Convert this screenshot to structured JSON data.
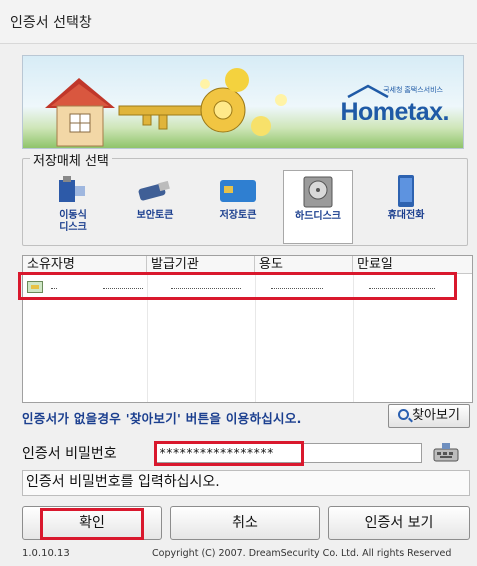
{
  "window": {
    "title": "인증서 선택창"
  },
  "banner": {
    "logo_text": "Hometax.",
    "logo_sub": "국세청 홈택스서비스"
  },
  "storage": {
    "group_title": "저장매체 선택",
    "media": [
      {
        "label_line1": "이동식",
        "label_line2": "디스크",
        "icon": "usb-drive-icon",
        "selected": false
      },
      {
        "label_line1": "보안토큰",
        "label_line2": "",
        "icon": "security-token-icon",
        "selected": false
      },
      {
        "label_line1": "저장토큰",
        "label_line2": "",
        "icon": "smart-card-icon",
        "selected": false
      },
      {
        "label_line1": "하드디스크",
        "label_line2": "",
        "icon": "hard-disk-icon",
        "selected": true
      },
      {
        "label_line1": "휴대전화",
        "label_line2": "",
        "icon": "mobile-phone-icon",
        "selected": false
      }
    ]
  },
  "cert_table": {
    "columns": [
      "소유자명",
      "발급기관",
      "용도",
      "만료일"
    ],
    "rows": [
      {
        "icon": "certificate-icon",
        "owner": "",
        "issuer": "",
        "usage": "",
        "expires": ""
      }
    ]
  },
  "help_text": "인증서가 없을경우 '찾아보기' 버튼을 이용하십시오.",
  "find_button": "찾아보기",
  "password": {
    "label": "인증서 비밀번호",
    "value": "*****************"
  },
  "status_message": "인증서 비밀번호를 입력하십시오.",
  "buttons": {
    "ok": "확인",
    "cancel": "취소",
    "view": "인증서 보기"
  },
  "footer": {
    "version": "1.0.10.13",
    "copyright": "Copyright (C) 2007. DreamSecurity Co. Ltd. All rights Reserved"
  },
  "colors": {
    "highlight": "#d9182d",
    "link_blue": "#1b3f8f",
    "brand_blue": "#1f5aa6"
  }
}
